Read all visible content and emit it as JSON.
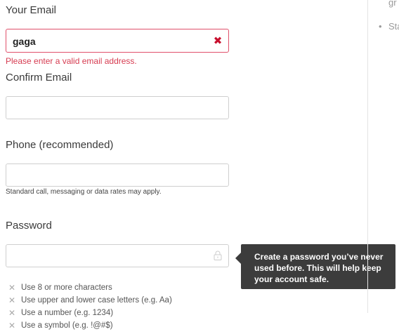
{
  "email": {
    "label": "Your Email",
    "value": "gaga",
    "error": "Please enter a valid email address.",
    "clear_icon": "close-icon"
  },
  "confirm_email": {
    "label": "Confirm Email",
    "value": ""
  },
  "phone": {
    "label": "Phone (recommended)",
    "value": "",
    "helper": "Standard call, messaging or data rates may apply."
  },
  "password": {
    "label": "Password",
    "value": "",
    "icon": "lock-icon",
    "tooltip": "Create a password you’ve never used before. This will help keep your account safe.",
    "requirements": [
      "Use 8 or more characters",
      "Use upper and lower case letters (e.g. Aa)",
      "Use a number (e.g. 1234)",
      "Use a symbol (e.g. !@#$)"
    ]
  },
  "sidebar": {
    "text_top": "gr",
    "bullet_text": "Sta"
  },
  "colors": {
    "error": "#d63b50",
    "tooltip_bg": "#3c3c3c"
  }
}
